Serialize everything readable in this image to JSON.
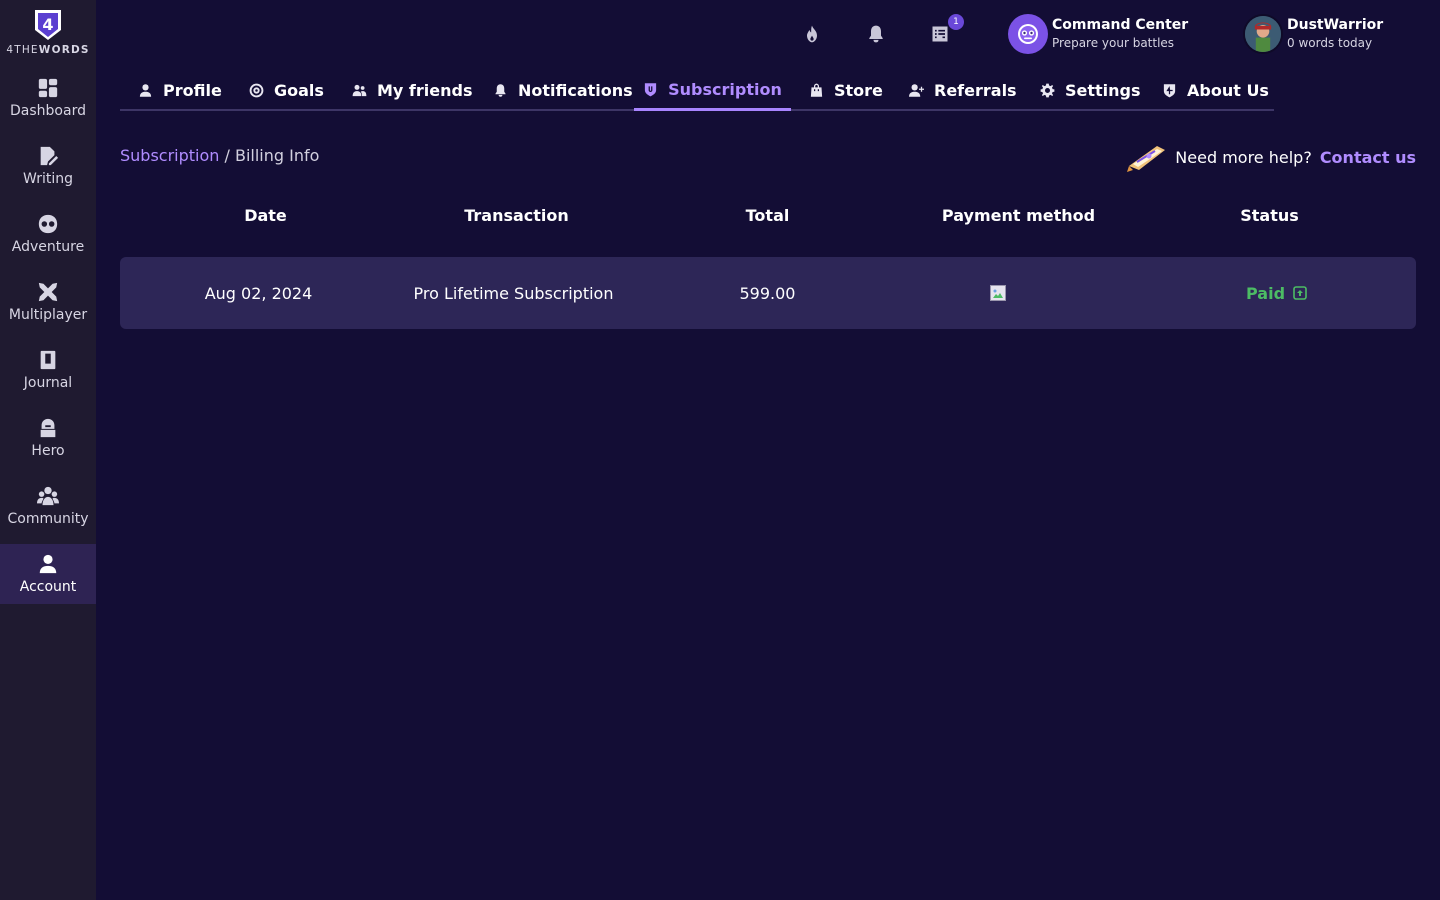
{
  "app": {
    "logo_text_light": "4THE",
    "logo_text_bold": "WORDS",
    "logo_glyph": "4"
  },
  "sidebar": {
    "items": [
      {
        "label": "Dashboard",
        "icon": "dashboard-icon",
        "active": false
      },
      {
        "label": "Writing",
        "icon": "writing-icon",
        "active": false
      },
      {
        "label": "Adventure",
        "icon": "adventure-icon",
        "active": false
      },
      {
        "label": "Multiplayer",
        "icon": "multiplayer-icon",
        "active": false
      },
      {
        "label": "Journal",
        "icon": "journal-icon",
        "active": false
      },
      {
        "label": "Hero",
        "icon": "hero-icon",
        "active": false
      },
      {
        "label": "Community",
        "icon": "community-icon",
        "active": false
      },
      {
        "label": "Account",
        "icon": "account-icon",
        "active": true
      }
    ]
  },
  "topbar": {
    "icons": [
      "flame-icon",
      "bell-icon",
      "quest-log-icon"
    ],
    "quest_badge": "1",
    "command_center": {
      "title": "Command Center",
      "subtitle": "Prepare your battles"
    },
    "user": {
      "name": "DustWarrior",
      "subtitle": "0 words today"
    }
  },
  "tabs": [
    {
      "label": "Profile",
      "icon": "user-icon",
      "active": false
    },
    {
      "label": "Goals",
      "icon": "target-icon",
      "active": false
    },
    {
      "label": "My friends",
      "icon": "friends-icon",
      "active": false
    },
    {
      "label": "Notifications",
      "icon": "bell-icon",
      "active": false
    },
    {
      "label": "Subscription",
      "icon": "shield-icon",
      "active": true
    },
    {
      "label": "Store",
      "icon": "bag-icon",
      "active": false
    },
    {
      "label": "Referrals",
      "icon": "user-plus-icon",
      "active": false
    },
    {
      "label": "Settings",
      "icon": "gear-icon",
      "active": false
    },
    {
      "label": "About Us",
      "icon": "about-icon",
      "active": false
    }
  ],
  "breadcrumb": {
    "parent": "Subscription",
    "separator": " / ",
    "current": "Billing Info"
  },
  "help": {
    "text": "Need more help?",
    "link": "Contact us"
  },
  "table": {
    "headers": [
      "Date",
      "Transaction",
      "Total",
      "Payment method",
      "Status"
    ],
    "rows": [
      {
        "date": "Aug 02, 2024",
        "transaction": "Pro Lifetime Subscription",
        "total": "599.00",
        "payment_method": "broken-image-icon",
        "status": "Paid"
      }
    ]
  },
  "colors": {
    "background": "#130d35",
    "sidebar": "#1f1a30",
    "accent": "#b08cff",
    "row": "#2d2657",
    "paid": "#4cbc64"
  }
}
